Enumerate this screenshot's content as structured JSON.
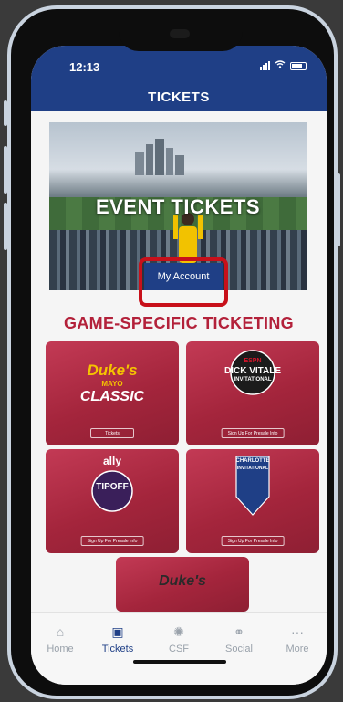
{
  "status": {
    "time": "12:13"
  },
  "header": {
    "title": "TICKETS"
  },
  "hero": {
    "label": "EVENT TICKETS",
    "button_label": "My Account"
  },
  "section": {
    "title": "GAME-SPECIFIC TICKETING"
  },
  "tiles": [
    {
      "logo_lines": [
        "Duke's",
        "MAYO",
        "CLASSIC"
      ],
      "button": "Tickets"
    },
    {
      "logo_lines": [
        "ESPN",
        "DICK VITALE",
        "INVITATIONAL"
      ],
      "button": "Sign Up For Presale Info"
    },
    {
      "logo_lines": [
        "ally",
        "TIPOFF"
      ],
      "button": "Sign Up For Presale Info"
    },
    {
      "logo_lines": [
        "CHARLOTTE",
        "INVITATIONAL"
      ],
      "button": "Sign Up For Presale Info"
    },
    {
      "logo_lines": [
        "Duke's"
      ]
    }
  ],
  "tabbar": {
    "items": [
      {
        "label": "Home",
        "icon": "home-icon"
      },
      {
        "label": "Tickets",
        "icon": "ticket-icon"
      },
      {
        "label": "CSF",
        "icon": "csf-icon"
      },
      {
        "label": "Social",
        "icon": "share-icon"
      },
      {
        "label": "More",
        "icon": "more-icon"
      }
    ]
  },
  "colors": {
    "brand": "#1f3f86",
    "accent": "#b3213a",
    "highlight": "#c8101a"
  }
}
